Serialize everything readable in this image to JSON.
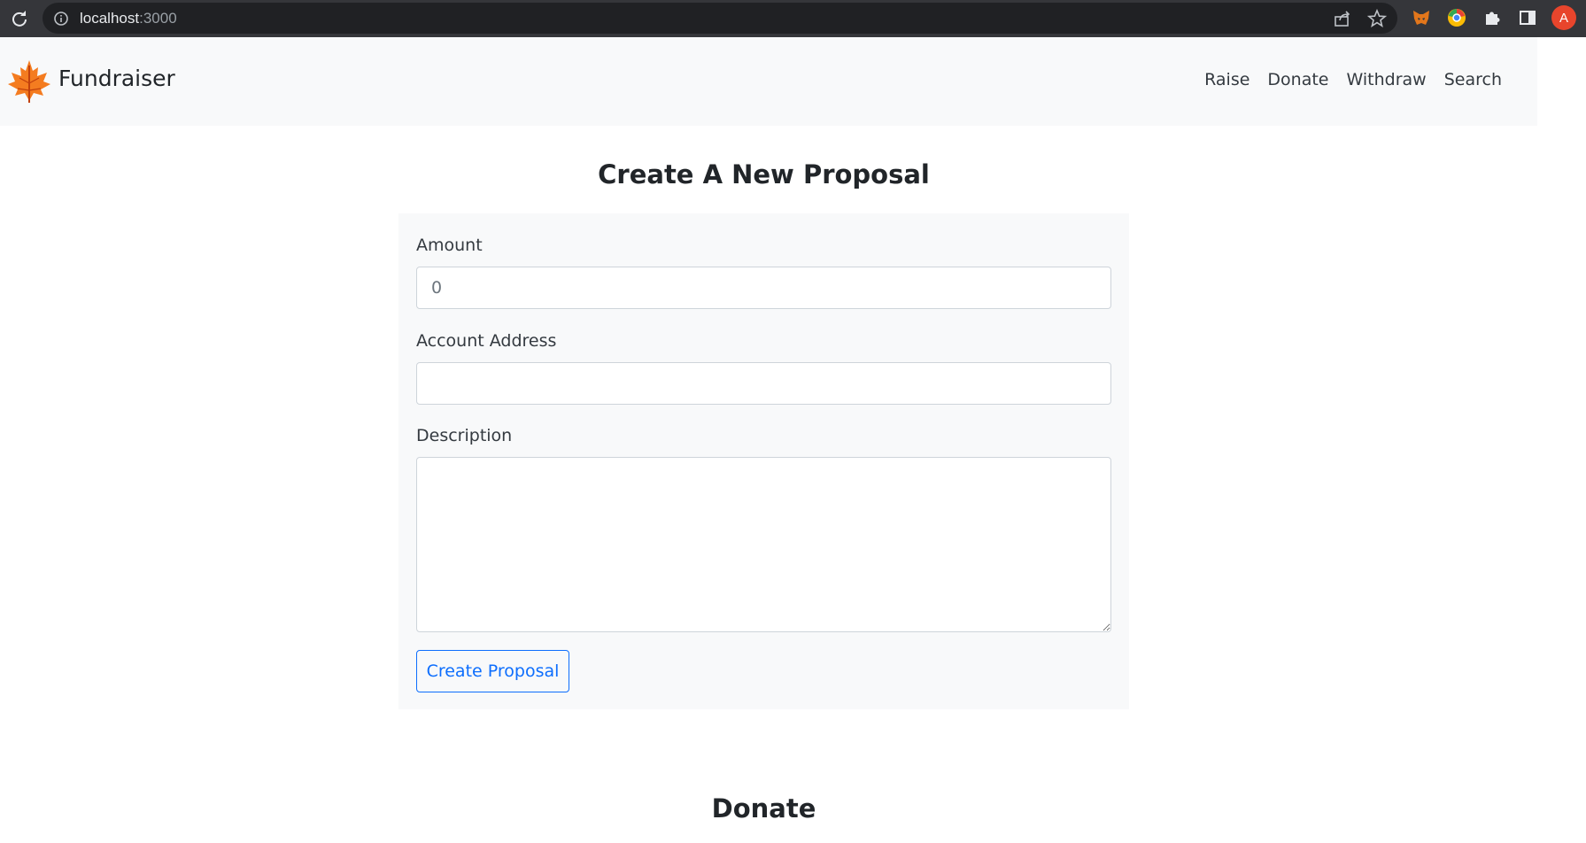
{
  "browser": {
    "url_host": "localhost",
    "url_port": ":3000",
    "avatar_letter": "A"
  },
  "navbar": {
    "brand": "Fundraiser",
    "links": [
      "Raise",
      "Donate",
      "Withdraw",
      "Search"
    ]
  },
  "proposal_form": {
    "title": "Create A New Proposal",
    "amount_label": "Amount",
    "amount_placeholder": "0",
    "address_label": "Account Address",
    "address_value": "",
    "description_label": "Description",
    "description_value": "",
    "submit_label": "Create Proposal"
  },
  "donate_section": {
    "title": "Donate"
  },
  "colors": {
    "chrome_bg": "#35363a",
    "navbar_bg": "#f8f9fa",
    "primary": "#0d6efd",
    "avatar": "#e8452c",
    "logo_orange": "#f47c20"
  }
}
